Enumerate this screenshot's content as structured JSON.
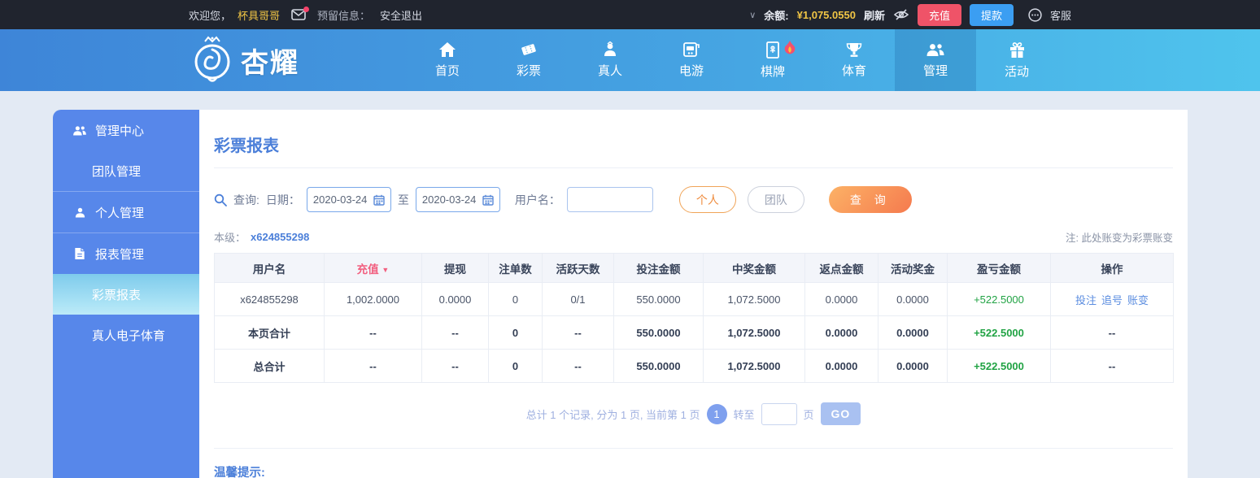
{
  "colors": {
    "accent_orange": "#f5794f",
    "profit_green": "#21a344",
    "link_blue": "#5b8de0",
    "sort_red": "#f25f7f",
    "balance_yellow": "#f0c545"
  },
  "topbar": {
    "welcome_prefix": "欢迎您，",
    "username": "杯具哥哥",
    "reserved_info_label": "预留信息：",
    "logout_label": "安全退出",
    "balance_chevron": "∨",
    "balance_label": "余额:",
    "balance_value": "¥1,075.0550",
    "refresh_label": "刷新",
    "recharge_label": "充值",
    "withdraw_label": "提款",
    "service_label": "客服"
  },
  "navbar": {
    "logo_text": "杏耀",
    "items": [
      {
        "label": "首页",
        "icon": "home-icon",
        "active": false
      },
      {
        "label": "彩票",
        "icon": "ticket-icon",
        "active": false
      },
      {
        "label": "真人",
        "icon": "live-person-icon",
        "active": false
      },
      {
        "label": "电游",
        "icon": "slot-machine-icon",
        "active": false
      },
      {
        "label": "棋牌",
        "icon": "mahjong-icon",
        "active": false,
        "hot": true
      },
      {
        "label": "体育",
        "icon": "trophy-icon",
        "active": false
      },
      {
        "label": "管理",
        "icon": "manage-users-icon",
        "active": true
      },
      {
        "label": "活动",
        "icon": "gift-icon",
        "active": false
      }
    ]
  },
  "sidebar": {
    "items": [
      {
        "label": "管理中心",
        "icon": "users-icon",
        "type": "group"
      },
      {
        "label": "团队管理",
        "type": "sub"
      },
      {
        "label": "个人管理",
        "icon": "person-icon",
        "type": "group"
      },
      {
        "label": "报表管理",
        "icon": "report-file-icon",
        "type": "group"
      },
      {
        "label": "彩票报表",
        "type": "sub",
        "active": true
      },
      {
        "label": "真人电子体育",
        "type": "sub"
      }
    ]
  },
  "main": {
    "page_title": "彩票报表",
    "query": {
      "query_label": "查询:",
      "date_label": "日期：",
      "date_from": "2020-03-24",
      "to_label": "至",
      "date_to": "2020-03-24",
      "username_label": "用户名：",
      "username_value": "",
      "personal_button": "个人",
      "team_button": "团队",
      "query_button": "查 询"
    },
    "level_label": "本级：",
    "level_user": "x624855298",
    "note": "注: 此处账变为彩票账变",
    "table": {
      "headers": [
        "用户名",
        "充值",
        "提现",
        "注单数",
        "活跃天数",
        "投注金额",
        "中奖金额",
        "返点金额",
        "活动奖金",
        "盈亏金额",
        "操作"
      ],
      "sort_caret": "▼",
      "rows": [
        {
          "cells": [
            "x624855298",
            "1,002.0000",
            "0.0000",
            "0",
            "0/1",
            "550.0000",
            "1,072.5000",
            "0.0000",
            "0.0000",
            "+522.5000"
          ]
        },
        {
          "cells": [
            "本页合计",
            "--",
            "--",
            "0",
            "--",
            "550.0000",
            "1,072.5000",
            "0.0000",
            "0.0000",
            "+522.5000",
            "--"
          ]
        },
        {
          "cells": [
            "总合计",
            "--",
            "--",
            "0",
            "--",
            "550.0000",
            "1,072.5000",
            "0.0000",
            "0.0000",
            "+522.5000",
            "--"
          ]
        }
      ],
      "action_links": [
        "投注",
        "追号",
        "账变"
      ]
    },
    "pagination": {
      "summary": "总计 1 个记录, 分为 1 页, 当前第 1 页",
      "current_page": "1",
      "goto_label": "转至",
      "page_unit": "页",
      "go_button": "GO"
    },
    "tips_title": "温馨提示:"
  }
}
